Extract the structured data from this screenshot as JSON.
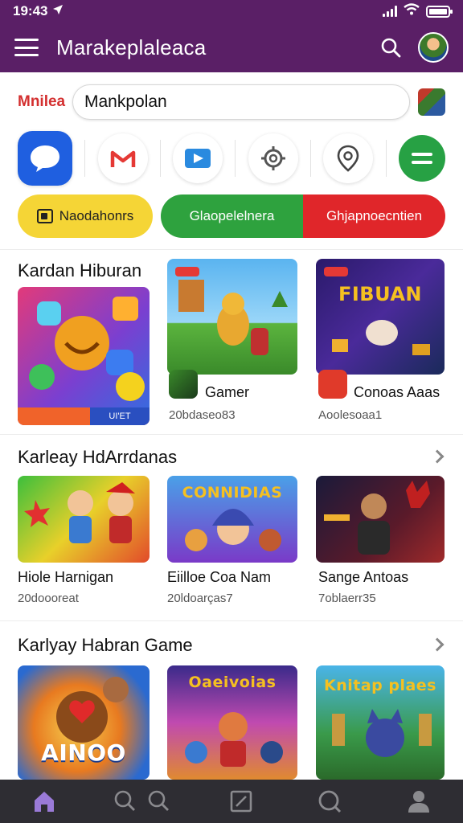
{
  "status": {
    "time": "19:43"
  },
  "app_bar": {
    "title": "Marakeplaleaca"
  },
  "search": {
    "brand": "Mnilea",
    "value": "Mankpolan"
  },
  "chips": {
    "yellow": "Naodahonrs",
    "green": "Glaopelelnera",
    "red": "Ghjapnoecntien"
  },
  "sections": [
    {
      "title": "Kardan Hiburan",
      "featured_label": "UI'ET",
      "games": [
        {
          "name": "Gamer",
          "sub": "20bdaseo83"
        },
        {
          "name": "Conoas Aaas",
          "sub": "Aoolesoaa1",
          "banner": "FIBUAN"
        }
      ]
    },
    {
      "title": "Karleay HdArrdanas",
      "games": [
        {
          "name": "Hiole Harnigan",
          "sub": "20doooreat"
        },
        {
          "name": "Eiilloe Coa Nam",
          "sub": "20ldoarças7",
          "banner": "CONNIDIAS"
        },
        {
          "name": "Sange Antoas",
          "sub": "7oblaerr35"
        }
      ]
    },
    {
      "title": "Karlyay Habran Game",
      "games": [
        {
          "banner": "AINOO"
        },
        {
          "banner": "Oaeivoias"
        },
        {
          "banner": "Knitap plaes"
        }
      ]
    }
  ],
  "colors": {
    "header": "#5a1f66",
    "accent_red": "#d32f2f",
    "green": "#2ea23e",
    "yellow": "#f5d536",
    "nav": "#2e2d33"
  }
}
